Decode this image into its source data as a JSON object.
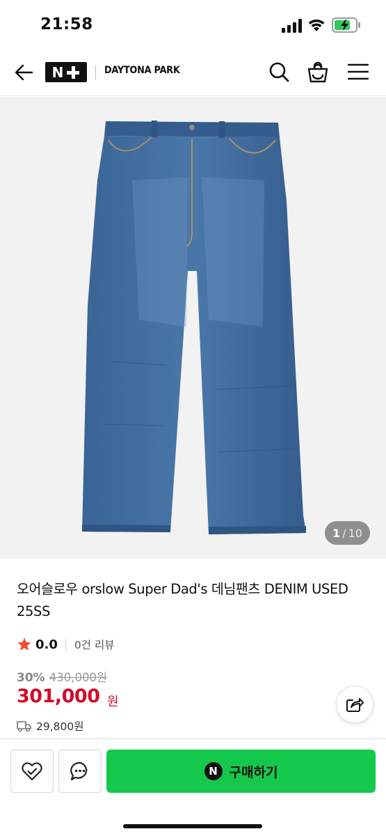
{
  "status_bar": {
    "time": "21:58"
  },
  "header": {
    "logo_n": "N",
    "brand": "DAYTONA PARK"
  },
  "gallery": {
    "current": "1",
    "separator": "/",
    "total": "10"
  },
  "product": {
    "title": "오어슬로우 orslow Super Dad's 데님팬츠 DENIM USED 25SS",
    "rating": "0.0",
    "review_count": "0건 리뷰",
    "discount_rate": "30%",
    "original_price": "430,000원",
    "sale_price": "301,000",
    "sale_unit": "원",
    "shipping_fee": "29,800원"
  },
  "actions": {
    "naver_n": "N",
    "buy_label": "구매하기"
  },
  "colors": {
    "sale_red": "#d20b2a",
    "buy_green": "#14c84b",
    "star_red": "#f04e31",
    "denim_blue": "#3d6a9c"
  }
}
